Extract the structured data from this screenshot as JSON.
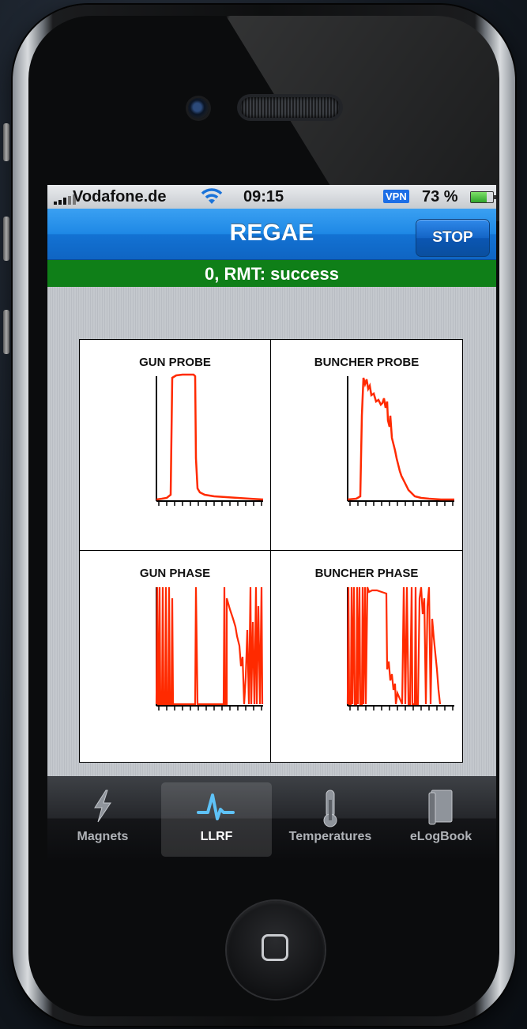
{
  "status_bar": {
    "carrier": "Vodafone.de",
    "time": "09:15",
    "vpn": "VPN",
    "battery": "73 %"
  },
  "nav": {
    "title": "REGAE",
    "stop_label": "STOP"
  },
  "status_banner": "0, RMT: success",
  "plots": [
    {
      "title": "GUN PROBE"
    },
    {
      "title": "BUNCHER PROBE"
    },
    {
      "title": "GUN PHASE"
    },
    {
      "title": "BUNCHER PHASE"
    }
  ],
  "tabs": [
    {
      "label": "Magnets",
      "icon": "lightning-bolt-icon",
      "active": false
    },
    {
      "label": "LLRF",
      "icon": "pulse-waveform-icon",
      "active": true
    },
    {
      "label": "Temperatures",
      "icon": "thermometer-icon",
      "active": false
    },
    {
      "label": "eLogBook",
      "icon": "book-icon",
      "active": false
    }
  ],
  "colors": {
    "nav_blue": "#1e88e5",
    "banner_green": "#0f7f18",
    "trace_red": "#ff2a00"
  }
}
